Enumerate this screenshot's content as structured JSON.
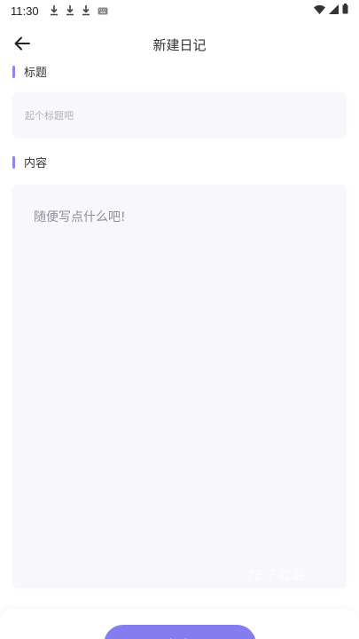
{
  "status_bar": {
    "time": "11:30"
  },
  "header": {
    "title": "新建日记"
  },
  "title_section": {
    "label": "标题",
    "placeholder": "起个标题吧"
  },
  "content_section": {
    "label": "内容",
    "placeholder": "随便写点什么吧!"
  },
  "watermark": {
    "text": "7E下载站"
  },
  "footer": {
    "save_label": "保存"
  },
  "colors": {
    "accent": "#837df0",
    "label_bar": "#8a86f0",
    "input_bg": "#f8f8fc"
  },
  "icons": [
    "back-arrow-icon",
    "download-icon",
    "keyboard-icon",
    "wifi-icon",
    "signal-icon",
    "battery-icon"
  ]
}
